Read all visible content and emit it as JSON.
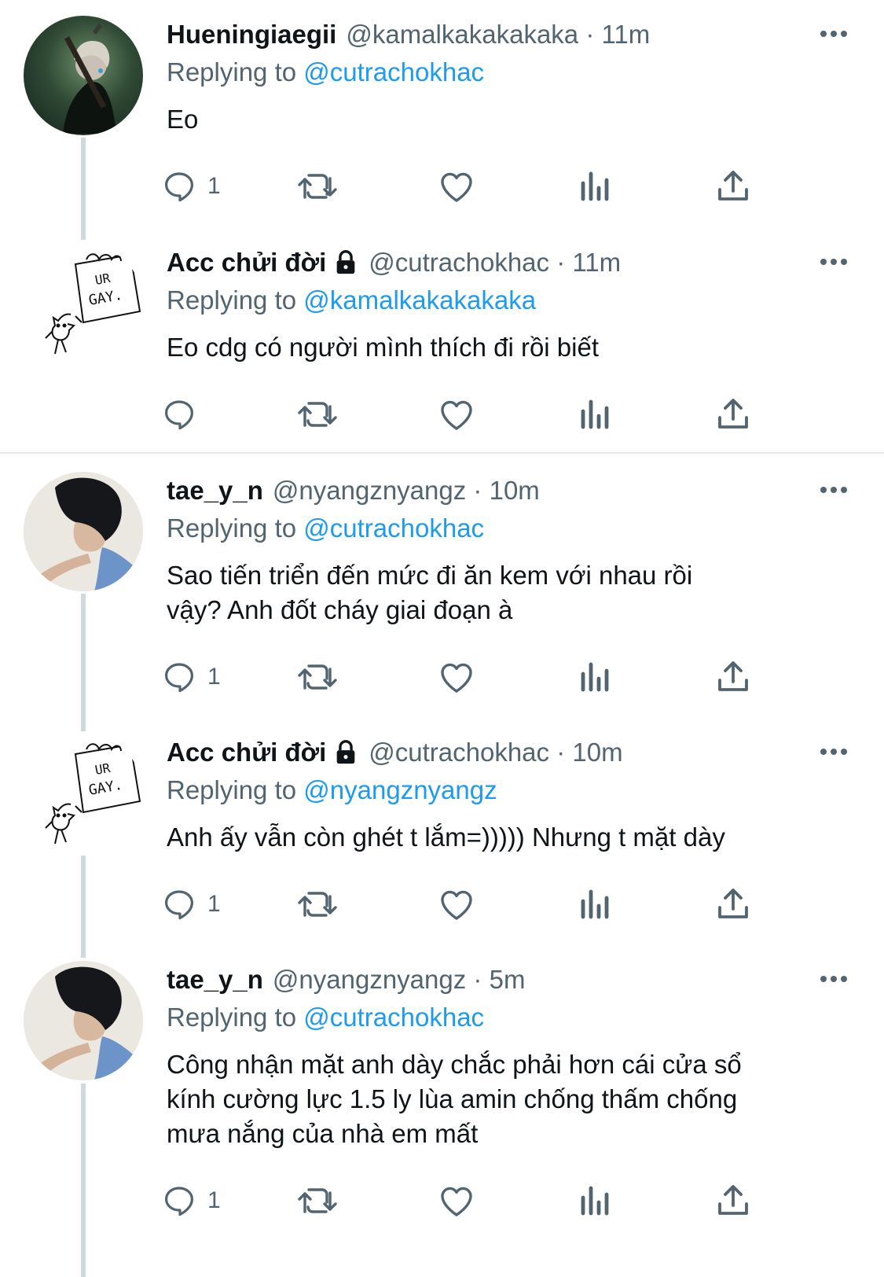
{
  "tweets": [
    {
      "name": "Hueningiaegii",
      "handle": "@kamalkakakakaka",
      "time": "11m",
      "replying_prefix": "Replying to",
      "replying_to": "@cutrachokhac",
      "text": "Eo",
      "reply_count": "1",
      "locked": false
    },
    {
      "name": "Acc chửi đời",
      "handle": "@cutrachokhac",
      "time": "11m",
      "replying_prefix": "Replying to",
      "replying_to": "@kamalkakakakaka",
      "text": "Eo cdg có người mình thích đi rồi biết",
      "reply_count": "",
      "locked": true
    },
    {
      "name": "tae_y_n",
      "handle": "@nyangznyangz",
      "time": "10m",
      "replying_prefix": "Replying to",
      "replying_to": "@cutrachokhac",
      "text_lines": [
        "Sao tiến triển đến mức đi ăn kem với nhau rồi",
        "vậy? Anh đốt cháy giai đoạn à"
      ],
      "reply_count": "1",
      "locked": false
    },
    {
      "name": "Acc chửi đời",
      "handle": "@cutrachokhac",
      "time": "10m",
      "replying_prefix": "Replying to",
      "replying_to": "@nyangznyangz",
      "text": "Anh ấy vẫn còn ghét t lắm=))))) Nhưng t mặt dày",
      "reply_count": "1",
      "locked": true
    },
    {
      "name": "tae_y_n",
      "handle": "@nyangznyangz",
      "time": "5m",
      "replying_prefix": "Replying to",
      "replying_to": "@cutrachokhac",
      "text_lines": [
        "Công nhận mặt anh dày chắc phải hơn cái cửa sổ",
        "kính cường lực 1.5 ly lùa amin chống thấm chống",
        "mưa nắng của nhà em mất"
      ],
      "reply_count": "1",
      "locked": false
    }
  ],
  "avatar_sign_text": [
    "UR",
    "GAY."
  ],
  "separator": "·",
  "icons": {
    "reply": "reply-icon",
    "retweet": "retweet-icon",
    "like": "heart-icon",
    "views": "views-icon",
    "share": "share-icon",
    "more": "more-icon",
    "lock": "lock-icon"
  },
  "colors": {
    "link": "#1d9bf0",
    "secondary": "#536471",
    "thread_line": "#cfd9de"
  }
}
